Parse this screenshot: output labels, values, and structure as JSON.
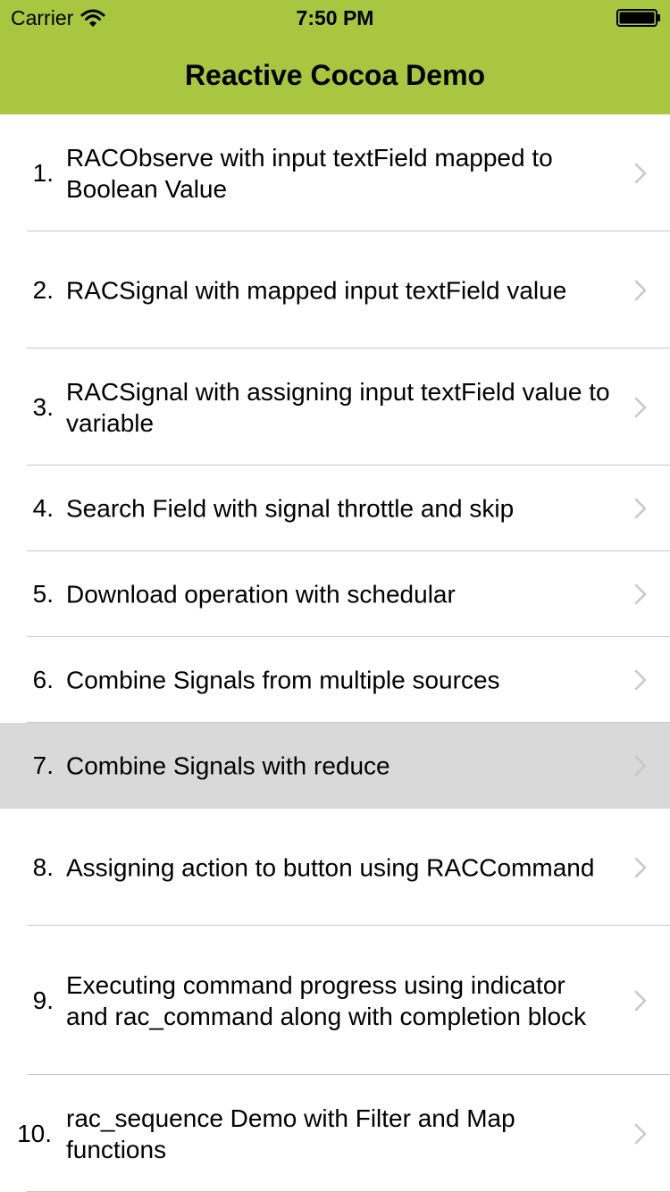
{
  "status_bar": {
    "carrier": "Carrier",
    "time": "7:50 PM"
  },
  "nav": {
    "title": "Reactive Cocoa Demo",
    "bar_color": "#a8c640"
  },
  "list": {
    "items": [
      {
        "number": "1.",
        "title": "RACObserve with input textField mapped to Boolean Value"
      },
      {
        "number": "2.",
        "title": "RACSignal with mapped input textField value"
      },
      {
        "number": "3.",
        "title": "RACSignal with assigning input textField value to variable"
      },
      {
        "number": "4.",
        "title": "Search Field with signal throttle and skip"
      },
      {
        "number": "5.",
        "title": "Download operation with schedular"
      },
      {
        "number": "6.",
        "title": "Combine Signals from multiple sources"
      },
      {
        "number": "7.",
        "title": "Combine Signals with reduce"
      },
      {
        "number": "8.",
        "title": "Assigning action to button using RACCommand"
      },
      {
        "number": "9.",
        "title": "Executing command progress using indicator and rac_command along with completion block"
      },
      {
        "number": "10.",
        "title": "rac_sequence Demo with Filter and Map functions"
      }
    ],
    "selected_index": 6
  }
}
